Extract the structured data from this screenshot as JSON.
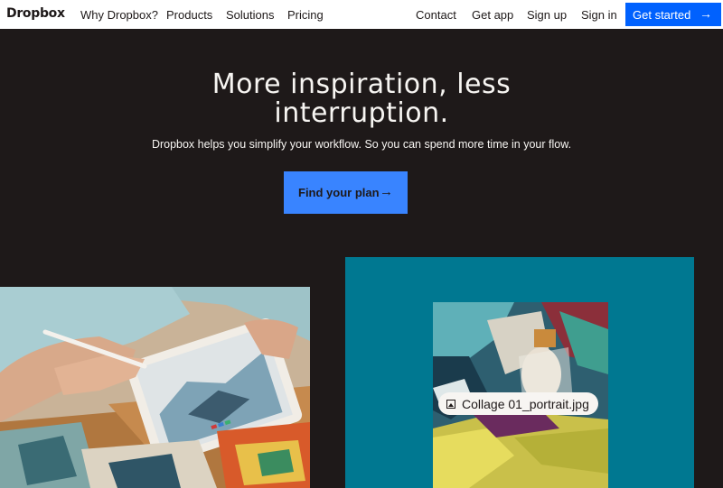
{
  "nav": {
    "logo": "Dropbox",
    "links": [
      "Why Dropbox?",
      "Products",
      "Solutions",
      "Pricing"
    ],
    "right_links": [
      "Contact",
      "Get app",
      "Sign up",
      "Sign in"
    ],
    "cta_label": "Get started",
    "cta_color": "#0061fe"
  },
  "hero": {
    "title_line1": "More inspiration, less",
    "title_line2": "interruption.",
    "subtitle": "Dropbox helps you simplify your workflow. So you can spend more time in your flow.",
    "button_label": "Find your plan",
    "button_color": "#3984ff",
    "background": "#1e1919"
  },
  "panel": {
    "teal_color": "#007891",
    "file_name": "Collage 01_portrait.jpg",
    "file_icon": "image-icon"
  }
}
